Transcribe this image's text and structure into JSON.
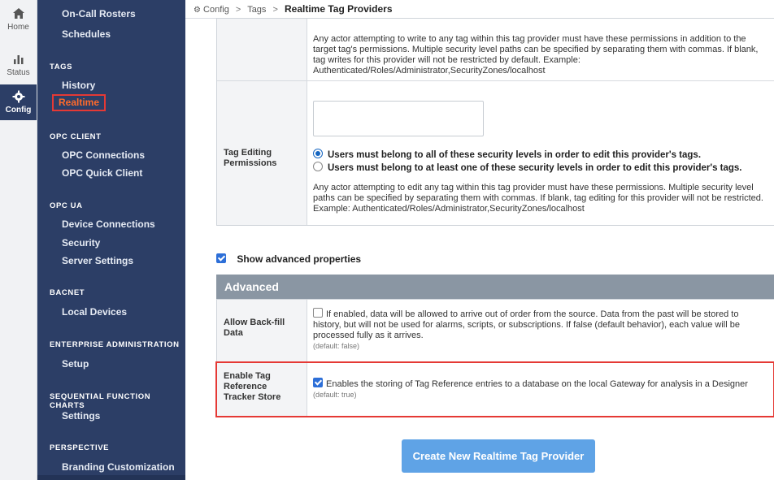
{
  "rail": {
    "items": [
      {
        "label": "Home",
        "icon": "home-icon"
      },
      {
        "label": "Status",
        "icon": "chart-bars-icon"
      },
      {
        "label": "Config",
        "icon": "gear-icon"
      }
    ]
  },
  "sidebar": {
    "links_top": [
      "On-Call Rosters",
      "Schedules"
    ],
    "tags_head": "TAGS",
    "tags_links": [
      "History",
      "Realtime"
    ],
    "opc_client_head": "OPC CLIENT",
    "opc_client_links": [
      "OPC Connections",
      "OPC Quick Client"
    ],
    "opc_ua_head": "OPC UA",
    "opc_ua_links": [
      "Device Connections",
      "Security",
      "Server Settings"
    ],
    "bacnet_head": "BACNET",
    "bacnet_links": [
      "Local Devices"
    ],
    "enterprise_head": "ENTERPRISE ADMINISTRATION",
    "enterprise_links": [
      "Setup"
    ],
    "sfc_head": "SEQUENTIAL FUNCTION CHARTS",
    "sfc_links": [
      "Settings"
    ],
    "perspective_head": "PERSPECTIVE",
    "perspective_links": [
      "Branding Customization"
    ]
  },
  "breadcrumb": {
    "config": "Config",
    "tags": "Tags",
    "current": "Realtime Tag Providers"
  },
  "write_perm": {
    "description": "Any actor attempting to write to any tag within this tag provider must have these permissions in addition to the target tag's permissions. Multiple security level paths can be specified by separating them with commas. If blank, tag writes for this provider will not be restricted by default. Example: Authenticated/Roles/Administrator,SecurityZones/localhost"
  },
  "edit_perm": {
    "label": "Tag Editing Permissions",
    "radio_all": "Users must belong to all of these security levels in order to edit this provider's tags.",
    "radio_any": "Users must belong to at least one of these security levels in order to edit this provider's tags.",
    "description": "Any actor attempting to edit any tag within this tag provider must have these permissions. Multiple security level paths can be specified by separating them with commas. If blank, tag editing for this provider will not be restricted. Example: Authenticated/Roles/Administrator,SecurityZones/localhost"
  },
  "show_advanced": "Show advanced properties",
  "advanced": {
    "header": "Advanced",
    "backfill": {
      "label": "Allow Back-fill Data",
      "description": "If enabled, data will be allowed to arrive out of order from the source. Data from the past will be stored to history, but will not be used for alarms, scripts, or subscriptions. If false (default behavior), each value will be processed fully as it arrives.",
      "default": "(default: false)"
    },
    "tracker": {
      "label": "Enable Tag Reference Tracker Store",
      "description": "Enables the storing of Tag Reference entries to a database on the local Gateway for analysis in a Designer",
      "default": "(default: true)"
    }
  },
  "create_button": "Create New Realtime Tag Provider"
}
